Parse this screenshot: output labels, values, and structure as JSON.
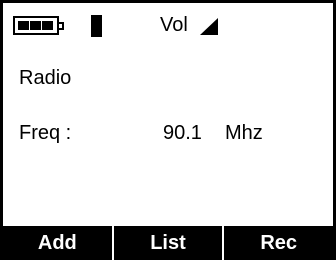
{
  "status": {
    "battery_icon": "battery-full-icon",
    "signal_icon": "signal-bar-icon",
    "volume_label": "Vol",
    "volume_icon": "volume-triangle-icon"
  },
  "screen": {
    "title": "Radio",
    "frequency_label": "Freq :",
    "frequency_value": "90.1",
    "frequency_unit": "Mhz"
  },
  "softkeys": [
    {
      "label": "Add"
    },
    {
      "label": "List"
    },
    {
      "label": "Rec"
    }
  ]
}
